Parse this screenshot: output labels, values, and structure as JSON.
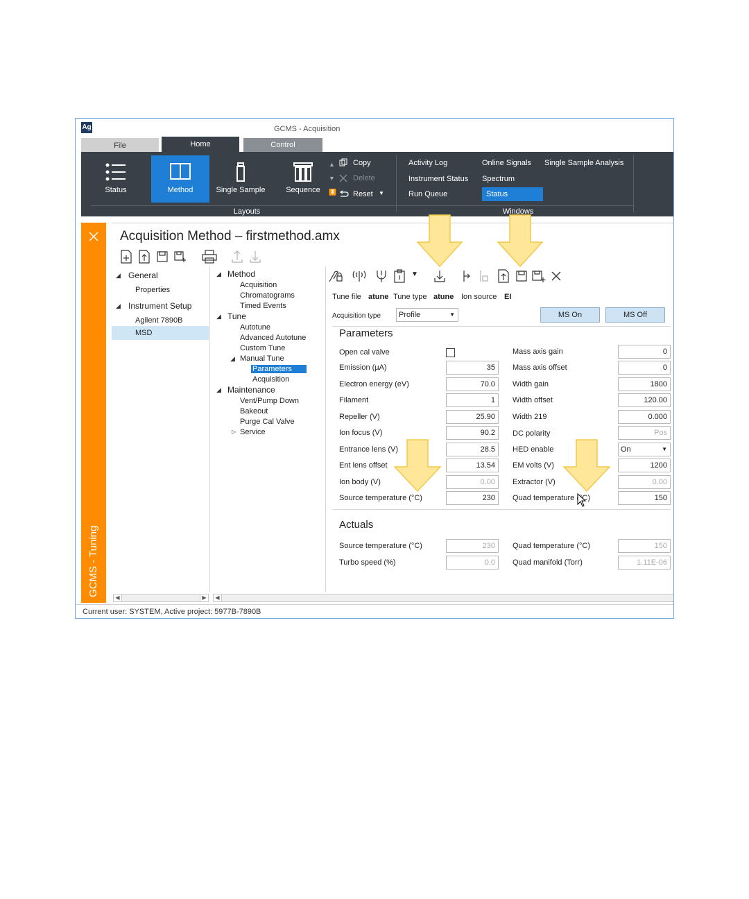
{
  "window": {
    "title": "GCMS - Acquisition",
    "logo": "Ag"
  },
  "menu_tabs": {
    "file": "File",
    "home": "Home",
    "control": "Control"
  },
  "ribbon": {
    "status": "Status",
    "method": "Method",
    "single_sample": "Single Sample",
    "sequence": "Sequence",
    "copy": "Copy",
    "delete": "Delete",
    "reset": "Reset",
    "layouts_group": "Layouts",
    "windows_group": "Windows",
    "activity_log": "Activity Log",
    "instrument_status": "Instrument Status",
    "run_queue": "Run Queue",
    "online_signals": "Online Signals",
    "spectrum": "Spectrum",
    "status_window": "Status",
    "single_sample_analysis": "Single Sample Analysis"
  },
  "side_strip": {
    "label": "GCMS - Tuning"
  },
  "page": {
    "title": "Acquisition Method – firstmethod.amx"
  },
  "left_nav": {
    "general": "General",
    "properties": "Properties",
    "instrument_setup": "Instrument Setup",
    "agilent": "Agilent 7890B",
    "msd": "MSD"
  },
  "mid_nav": {
    "method": "Method",
    "acquisition": "Acquisition",
    "chromatograms": "Chromatograms",
    "timed_events": "Timed Events",
    "tune": "Tune",
    "autotune": "Autotune",
    "advanced_autotune": "Advanced Autotune",
    "custom_tune": "Custom Tune",
    "manual_tune": "Manual Tune",
    "parameters": "Parameters",
    "acquisition_sub": "Acquisition",
    "maintenance": "Maintenance",
    "vent_pump": "Vent/Pump Down",
    "bakeout": "Bakeout",
    "purge_cal": "Purge Cal Valve",
    "service": "Service"
  },
  "tune_info": {
    "tune_file_label": "Tune file",
    "tune_file_value": "atune",
    "tune_type_label": "Tune type",
    "tune_type_value": "atune",
    "ion_source_label": "Ion source",
    "ion_source_value": "EI"
  },
  "acq_type": {
    "label": "Acquisition type",
    "value": "Profile"
  },
  "ms_on": "MS On",
  "ms_off": "MS Off",
  "parameters": {
    "heading": "Parameters",
    "open_cal_valve": "Open cal valve",
    "emission_label": "Emission (µA)",
    "emission": "35",
    "electron_energy_label": "Electron energy (eV)",
    "electron_energy": "70.0",
    "filament_label": "Filament",
    "filament": "1",
    "repeller_label": "Repeller (V)",
    "repeller": "25.90",
    "ion_focus_label": "Ion focus (V)",
    "ion_focus": "90.2",
    "entrance_lens_label": "Entrance lens (V)",
    "entrance_lens": "28.5",
    "ent_lens_offset_label": "Ent lens offset",
    "ent_lens_offset": "13.54",
    "ion_body_label": "Ion body (V)",
    "ion_body": "0.00",
    "source_temp_label": "Source temperature (°C)",
    "source_temp": "230",
    "mass_axis_gain_label": "Mass axis gain",
    "mass_axis_gain": "0",
    "mass_axis_offset_label": "Mass axis offset",
    "mass_axis_offset": "0",
    "width_gain_label": "Width gain",
    "width_gain": "1800",
    "width_offset_label": "Width offset",
    "width_offset": "120.00",
    "width_219_label": "Width 219",
    "width_219": "0.000",
    "dc_polarity_label": "DC polarity",
    "dc_polarity": "Pos",
    "hed_enable_label": "HED enable",
    "hed_enable": "On",
    "em_volts_label": "EM volts (V)",
    "em_volts": "1200",
    "extractor_label": "Extractor (V)",
    "extractor": "0.00",
    "quad_temp_label": "Quad temperature (°C)",
    "quad_temp": "150"
  },
  "actuals": {
    "heading": "Actuals",
    "source_temp_label": "Source temperature (°C)",
    "source_temp": "230",
    "turbo_label": "Turbo speed (%)",
    "turbo": "0.0",
    "quad_temp_label": "Quad temperature (°C)",
    "quad_temp": "150",
    "quad_manifold_label": "Quad manifold (Torr)",
    "quad_manifold": "1.11E-06"
  },
  "statusbar": {
    "text": "Current user: SYSTEM, Active project: 5977B-7890B"
  },
  "colors": {
    "accent": "#1f7fd6",
    "ribbon": "#3a4048",
    "strip": "#ff8c00",
    "arrow": "#ffd966"
  }
}
